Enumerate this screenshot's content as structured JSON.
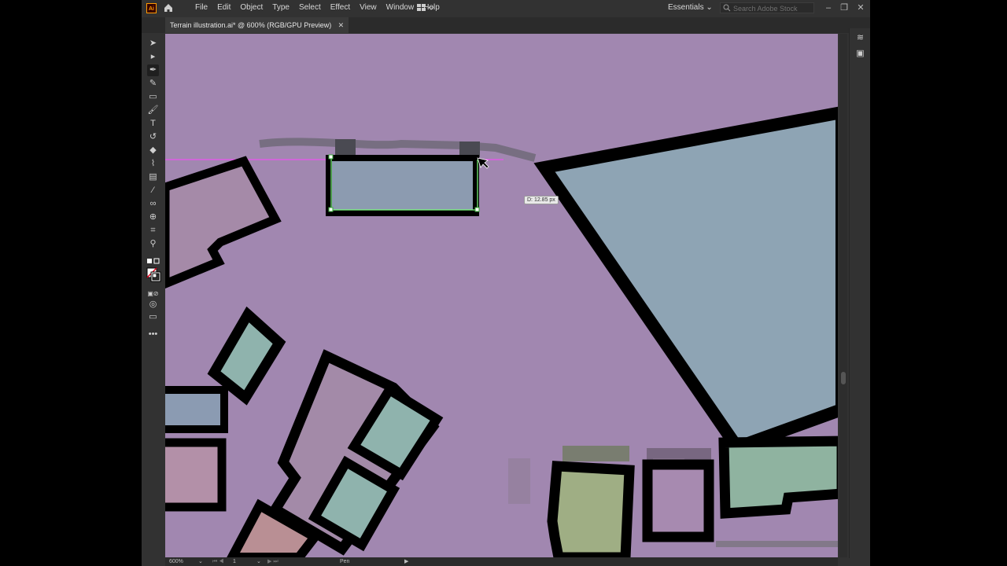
{
  "app": {
    "logo": "Ai",
    "accent": "#ff9a00"
  },
  "menu": [
    "File",
    "Edit",
    "Object",
    "Type",
    "Select",
    "Effect",
    "View",
    "Window",
    "Help"
  ],
  "workspace": {
    "label": "Essentials"
  },
  "search": {
    "placeholder": "Search Adobe Stock"
  },
  "document": {
    "tab_title": "Terrain illustration.ai* @ 600% (RGB/GPU Preview)"
  },
  "canvas": {
    "measurement_tooltip": "D: 12.85 px",
    "background_color": "#a187b0",
    "smart_guide_color": "#ff44ff",
    "selection_color": "#7cff7c"
  },
  "status": {
    "zoom": "600%",
    "artboard": "1",
    "tool": "Pen"
  },
  "icons": {
    "tools": [
      "selection-icon",
      "direct-selection-icon",
      "pen-icon",
      "curvature-icon",
      "rectangle-icon",
      "paintbrush-icon",
      "type-icon",
      "rotate-icon",
      "eraser-icon",
      "width-icon",
      "gradient-icon",
      "eyedropper-icon",
      "blend-icon",
      "shape-builder-icon",
      "artboard-icon",
      "zoom-icon",
      "fill-stroke-icon",
      "edit-toolbar-icon"
    ],
    "panels": [
      "layers-icon",
      "libraries-icon"
    ]
  }
}
